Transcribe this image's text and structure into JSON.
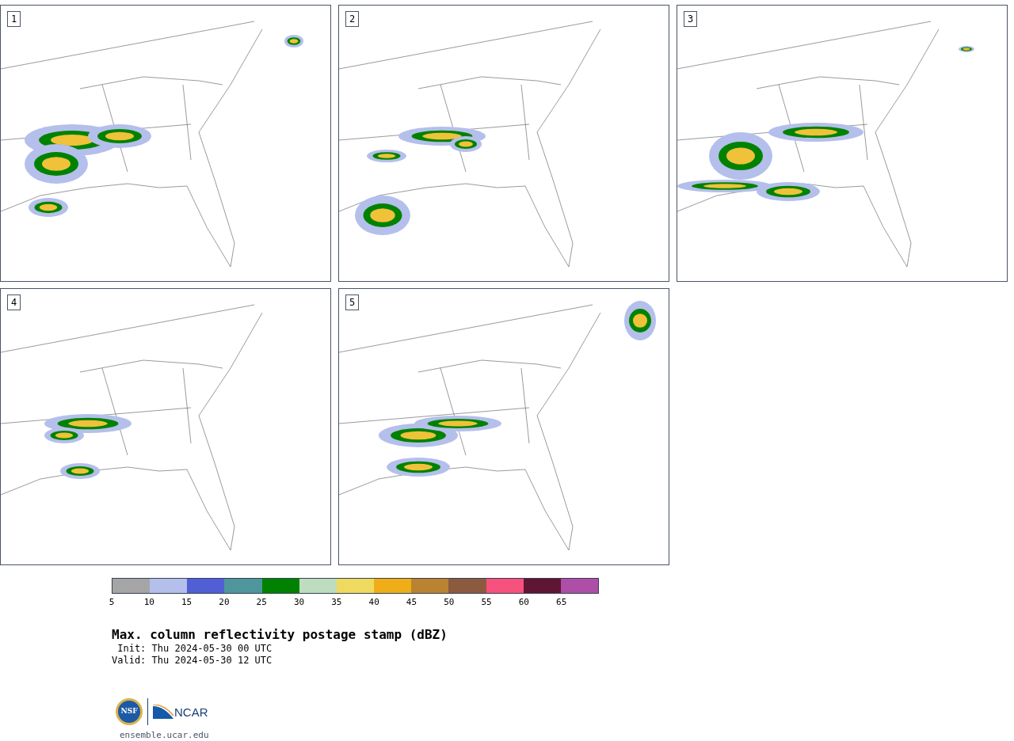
{
  "panels": [
    {
      "number": "1"
    },
    {
      "number": "2"
    },
    {
      "number": "3"
    },
    {
      "number": "4"
    },
    {
      "number": "5"
    }
  ],
  "colorbar": [
    {
      "color": "#a5a5a5",
      "tick": "5"
    },
    {
      "color": "#b4bfeb",
      "tick": "10"
    },
    {
      "color": "#505fd5",
      "tick": "15"
    },
    {
      "color": "#4f969c",
      "tick": "20"
    },
    {
      "color": "#008200",
      "tick": "25"
    },
    {
      "color": "#bedcbe",
      "tick": "30"
    },
    {
      "color": "#efda5f",
      "tick": "35"
    },
    {
      "color": "#efae18",
      "tick": "40"
    },
    {
      "color": "#ba8331",
      "tick": "45"
    },
    {
      "color": "#8b5a3f",
      "tick": "50"
    },
    {
      "color": "#f6517c",
      "tick": "55"
    },
    {
      "color": "#5f1633",
      "tick": "60"
    },
    {
      "color": "#ae4ea6",
      "tick": "65"
    }
  ],
  "title": "Max. column reflectivity postage stamp (dBZ)",
  "init": " Init: Thu 2024-05-30 00 UTC",
  "valid": "Valid: Thu 2024-05-30 12 UTC",
  "logo": {
    "left": "NSF",
    "right": "NCAR"
  },
  "url": "ensemble.ucar.edu"
}
